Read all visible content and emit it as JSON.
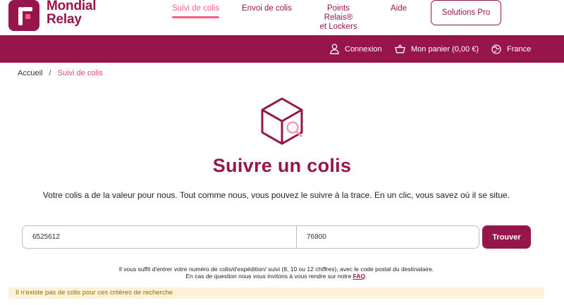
{
  "brand": {
    "line1": "Mondial",
    "line2": "Relay",
    "color": "#96154a",
    "accent": "#ff5c84"
  },
  "nav": {
    "suivi": "Suivi de colis",
    "envoi": "Envoi de colis",
    "points_line1": "Points Relais®",
    "points_line2": "et Lockers",
    "aide": "Aide",
    "solutions": "Solutions Pro"
  },
  "topbar": {
    "connexion": "Connexion",
    "panier": "Mon panier (0,00 €)",
    "country": "France"
  },
  "breadcrumb": {
    "home": "Accueil",
    "separator": "/",
    "current": "Suivi de colis"
  },
  "hero": {
    "title": "Suivre un colis",
    "intro": "Votre colis a de la valeur pour nous. Tout comme nous, vous pouvez le suivre à la trace. En un clic, vous savez où il se situe."
  },
  "form": {
    "tracking_value": "6525612",
    "postal_value": "76800",
    "submit_label": "Trouver"
  },
  "help": {
    "line1": "Il vous suffit d'entrer votre numéro de colis/d'expédition/ suivi (8, 10 ou 12 chiffres), avec le code postal du destinataire.",
    "line2_prefix": "En cas de question nous vous invitons à vous rendre sur notre ",
    "faq_link": "FAQ",
    "line2_suffix": "."
  },
  "alert": {
    "message": "Il n'existe pas de colis pour ces critères de recherche"
  }
}
